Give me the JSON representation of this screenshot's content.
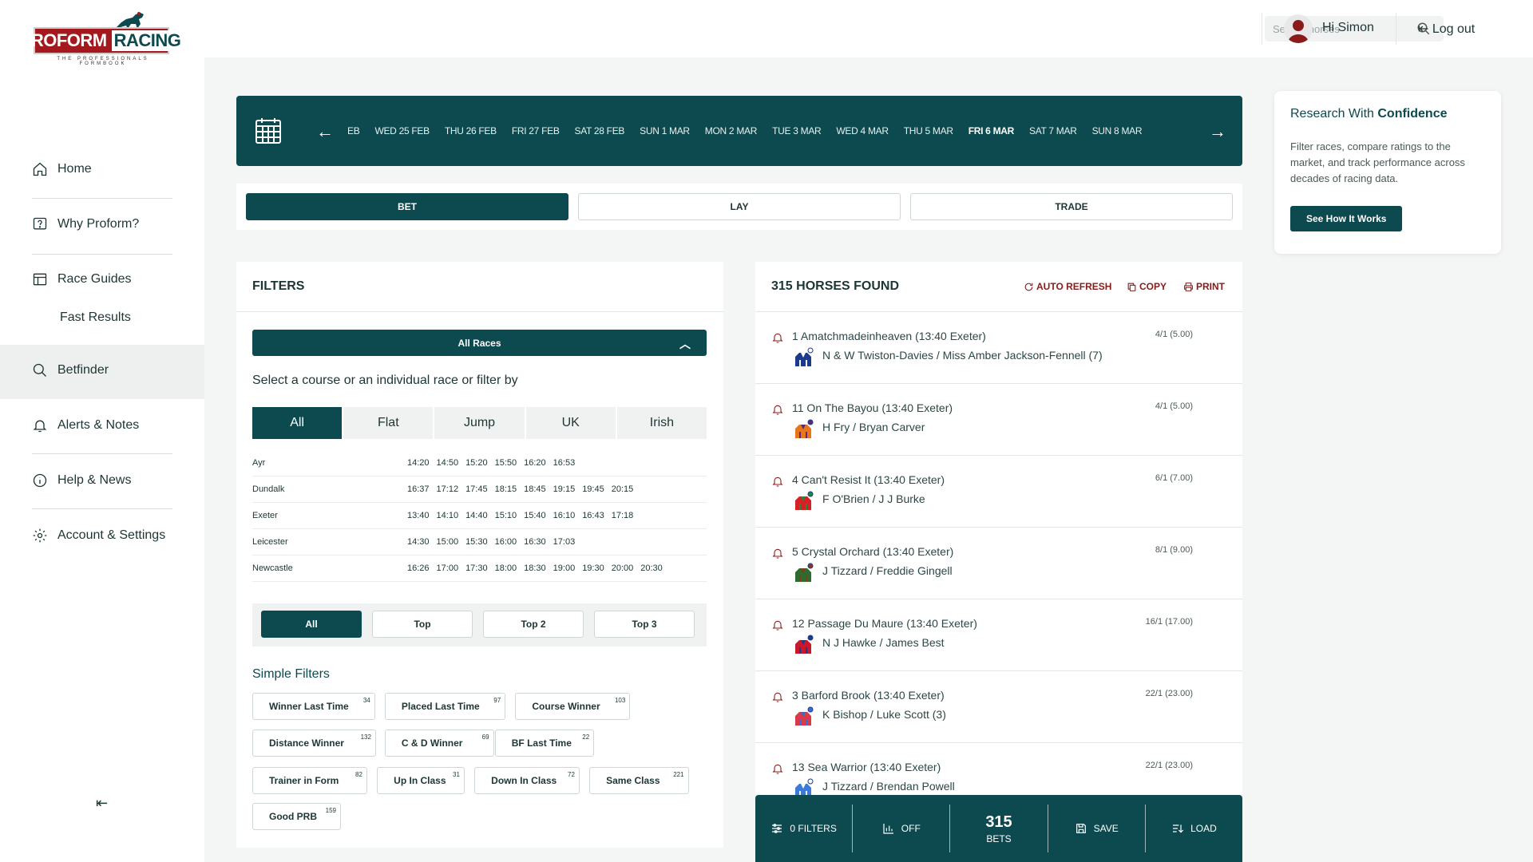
{
  "brand": {
    "name_part1": "PROFORM",
    "name_part2": "RACING",
    "tagline": "THE PROFESSIONALS FORMBOOK",
    "color_primary": "#0d4a4f",
    "color_accent": "#a4191d"
  },
  "sidebar": {
    "items": [
      {
        "label": "Home",
        "icon": "home-icon"
      },
      {
        "label": "Why Proform?",
        "icon": "question-icon"
      },
      {
        "label": "Race Guides",
        "icon": "calendar-icon"
      },
      {
        "label": "Fast Results",
        "icon": ""
      },
      {
        "label": "Betfinder",
        "icon": "search-icon"
      },
      {
        "label": "Alerts & Notes",
        "icon": "bell-icon"
      },
      {
        "label": "Help & News",
        "icon": "info-icon"
      },
      {
        "label": "Account & Settings",
        "icon": "gear-icon"
      }
    ],
    "collapse_glyph": "⇤"
  },
  "header": {
    "search_placeholder": "Search horses",
    "greeting": "Hi Simon",
    "logout": "Log out"
  },
  "datebar": {
    "dates": [
      "FEB",
      "WED 25 FEB",
      "THU 26 FEB",
      "FRI 27 FEB",
      "SAT 28 FEB",
      "SUN 1 MAR",
      "MON 2 MAR",
      "TUE 3 MAR",
      "WED 4 MAR",
      "THU 5 MAR",
      "FRI 6 MAR",
      "SAT 7 MAR",
      "SUN 8 MAR"
    ],
    "active": "FRI 6 MAR"
  },
  "modes": {
    "bet": "BET",
    "lay": "LAY",
    "trade": "TRADE",
    "active": "BET"
  },
  "promo": {
    "title_prefix": "Research With ",
    "title_bold": "Confidence",
    "body": "Filter races, compare ratings to the market, and track performance across decades of racing data.",
    "button": "See How It Works"
  },
  "filters": {
    "title": "FILTERS",
    "all_races": "All Races",
    "select_text": "Select a course or an individual race or filter by",
    "type_tabs": [
      "All",
      "Flat",
      "Jump",
      "UK",
      "Irish"
    ],
    "courses": [
      {
        "name": "Ayr",
        "times": [
          "14:20",
          "14:50",
          "15:20",
          "15:50",
          "16:20",
          "16:53"
        ]
      },
      {
        "name": "Dundalk",
        "times": [
          "16:37",
          "17:12",
          "17:45",
          "18:15",
          "18:45",
          "19:15",
          "19:45",
          "20:15"
        ]
      },
      {
        "name": "Exeter",
        "times": [
          "13:40",
          "14:10",
          "14:40",
          "15:10",
          "15:40",
          "16:10",
          "16:43",
          "17:18"
        ]
      },
      {
        "name": "Leicester",
        "times": [
          "14:30",
          "15:00",
          "15:30",
          "16:00",
          "16:30",
          "17:03"
        ]
      },
      {
        "name": "Newcastle",
        "times": [
          "16:26",
          "17:00",
          "17:30",
          "18:00",
          "18:30",
          "19:00",
          "19:30",
          "20:00",
          "20:30"
        ]
      }
    ],
    "top_options": [
      "All",
      "Top",
      "Top 2",
      "Top 3"
    ],
    "simple_filters_title": "Simple Filters",
    "chips": [
      {
        "label": "Winner Last Time",
        "count": "34"
      },
      {
        "label": "Placed Last Time",
        "count": "97"
      },
      {
        "label": "Course Winner",
        "count": "103"
      },
      {
        "label": "Distance Winner",
        "count": "132"
      },
      {
        "label": "C & D Winner",
        "count": "69"
      },
      {
        "label": "BF Last Time",
        "count": "22"
      },
      {
        "label": "Trainer in Form",
        "count": "82"
      },
      {
        "label": "Up In Class",
        "count": "31"
      },
      {
        "label": "Down In Class",
        "count": "72"
      },
      {
        "label": "Same Class",
        "count": "221"
      },
      {
        "label": "Good PRB",
        "count": "159"
      }
    ]
  },
  "results": {
    "title": "315 HORSES FOUND",
    "auto_refresh": "AUTO REFRESH",
    "copy": "COPY",
    "print": "PRINT",
    "horses": [
      {
        "name": "1 Amatchmadeinheaven (13:40 Exeter)",
        "connections": "N & W Twiston-Davies / Miss Amber Jackson-Fennell (7)",
        "odds": "4/1 (5.00)",
        "silk": [
          "#1c3a8c",
          "#ffffff"
        ]
      },
      {
        "name": "11 On The Bayou (13:40 Exeter)",
        "connections": "H Fry / Bryan Carver",
        "odds": "4/1 (5.00)",
        "silk": [
          "#e8761c",
          "#5a2a7a"
        ]
      },
      {
        "name": "4 Can't Resist It (13:40 Exeter)",
        "connections": "F O'Brien / J J Burke",
        "odds": "6/1 (7.00)",
        "silk": [
          "#d91f26",
          "#1e8a3a"
        ]
      },
      {
        "name": "5 Crystal Orchard (13:40 Exeter)",
        "connections": "J Tizzard / Freddie Gingell",
        "odds": "8/1 (9.00)",
        "silk": [
          "#2e6b2e",
          "#8a3a1a"
        ]
      },
      {
        "name": "12 Passage Du Maure (13:40 Exeter)",
        "connections": "N J Hawke / James Best",
        "odds": "16/1 (17.00)",
        "silk": [
          "#c8182a",
          "#1c3a8c"
        ]
      },
      {
        "name": "3 Barford Brook (13:40 Exeter)",
        "connections": "K Bishop / Luke Scott (3)",
        "odds": "22/1 (23.00)",
        "silk": [
          "#d83a4a",
          "#3a6ad8"
        ]
      },
      {
        "name": "13 Sea Warrior (13:40 Exeter)",
        "connections": "J Tizzard / Brendan Powell",
        "odds": "22/1 (23.00)",
        "silk": [
          "#3a7ad8",
          "#ffffff"
        ]
      }
    ]
  },
  "bottom_bar": {
    "filters": "0 FILTERS",
    "off": "OFF",
    "bets_count": "315",
    "bets_label": "BETS",
    "save": "SAVE",
    "load": "LOAD"
  }
}
